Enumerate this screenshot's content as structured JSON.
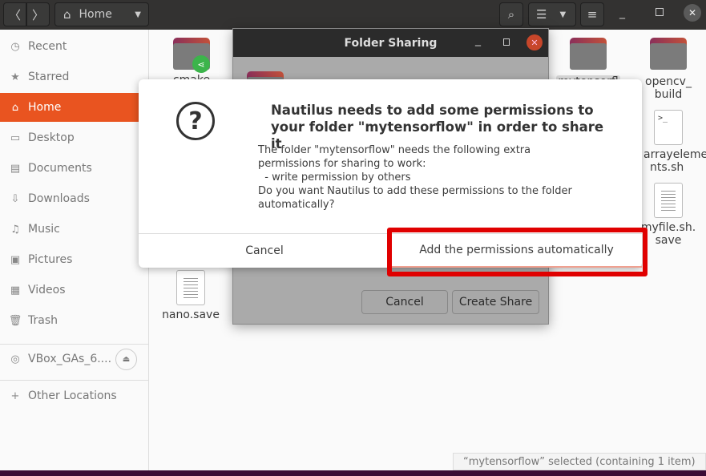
{
  "header": {
    "back": "〈",
    "forward": "〉",
    "location": "Home",
    "search_icon": "search-icon",
    "view_icon": "list-view-icon",
    "menu_icon": "hamburger-icon"
  },
  "sidebar": {
    "items": [
      {
        "label": "Recent",
        "icon": "clock-icon",
        "glyph": "◷"
      },
      {
        "label": "Starred",
        "icon": "star-icon",
        "glyph": "★"
      },
      {
        "label": "Home",
        "icon": "home-icon",
        "glyph": "⌂"
      },
      {
        "label": "Desktop",
        "icon": "desktop-icon",
        "glyph": "▭"
      },
      {
        "label": "Documents",
        "icon": "documents-icon",
        "glyph": "▤"
      },
      {
        "label": "Downloads",
        "icon": "download-icon",
        "glyph": "⇩"
      },
      {
        "label": "Music",
        "icon": "music-icon",
        "glyph": "♫"
      },
      {
        "label": "Pictures",
        "icon": "pictures-icon",
        "glyph": "▣"
      },
      {
        "label": "Videos",
        "icon": "videos-icon",
        "glyph": "▦"
      },
      {
        "label": "Trash",
        "icon": "trash-icon",
        "glyph": "🗑"
      }
    ],
    "device": "VBox_GAs_6....",
    "other": "Other Locations"
  },
  "files": {
    "cmake": "cmake",
    "mytensorflow": "mytensorfl",
    "opencv1": "opencv_",
    "opencv2": "build",
    "array1": "arrayeleme",
    "array2": "nts.sh",
    "myfile1": "myfile.sh.",
    "myfile2": "save",
    "nano": "nano.save"
  },
  "folder_sharing": {
    "title": "Folder Sharing",
    "cancel": "Cancel",
    "create": "Create Share"
  },
  "alert": {
    "title": "Nautilus needs to add some permissions to your folder \"mytensorflow\" in order to share it",
    "body": "The folder \"mytensorflow\" needs the following extra permissions for sharing to work:\n  - write permission by others\nDo you want Nautilus to add these permissions to the folder automatically?",
    "cancel": "Cancel",
    "confirm": "Add the permissions automatically"
  },
  "status": "“mytensorflow” selected  (containing 1 item)",
  "colors": {
    "accent": "#e95420",
    "highlight": "#e00000"
  }
}
